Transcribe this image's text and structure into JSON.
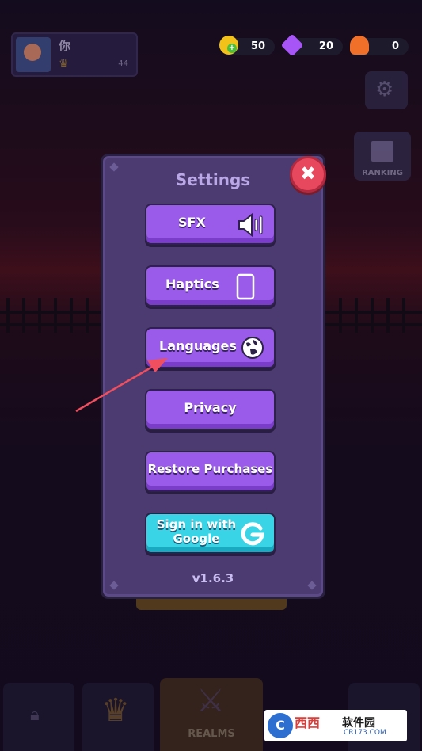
{
  "profile": {
    "name": "你",
    "level": "44"
  },
  "currencies": [
    {
      "icon": "gold-coin-icon",
      "value": "50",
      "color": "#f2c21a"
    },
    {
      "icon": "purple-gem-icon",
      "value": "20",
      "color": "#a855f7"
    },
    {
      "icon": "orange-gem-icon",
      "value": "0",
      "color": "#f0702a"
    }
  ],
  "side": {
    "ranking_label": "RANKING"
  },
  "settings": {
    "title": "Settings",
    "sfx_label": "SFX",
    "haptics_label": "Haptics",
    "languages_label": "Languages",
    "privacy_label": "Privacy",
    "restore_label": "Restore Purchases",
    "google_label_line1": "Sign in with",
    "google_label_line2": "Google",
    "version": "v1.6.3"
  },
  "bottom_nav": {
    "active_label": "REALMS"
  },
  "watermark": {
    "brand": "西西",
    "text": "软件园",
    "url": "CR173.COM"
  },
  "colors": {
    "button": "#9b5bea",
    "google": "#39d4e6",
    "close": "#e8485e",
    "panel": "#4b3b70"
  }
}
